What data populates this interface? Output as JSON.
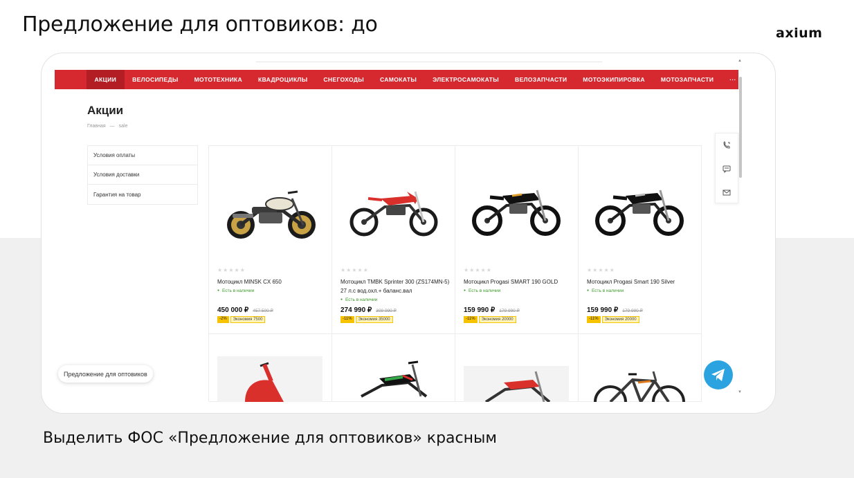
{
  "slide": {
    "title": "Предложение для оптовиков: до",
    "logo": "axium",
    "caption": "Выделить ФОС «Предложение для оптовиков» красным"
  },
  "site": {
    "nav": [
      "АКЦИИ",
      "ВЕЛОСИПЕДЫ",
      "МОТОТЕХНИКА",
      "КВАДРОЦИКЛЫ",
      "СНЕГОХОДЫ",
      "САМОКАТЫ",
      "ЭЛЕКТРОСАМОКАТЫ",
      "ВЕЛОЗАПЧАСТИ",
      "МОТОЭКИПИРОВКА",
      "МОТОЗАПЧАСТИ",
      "···"
    ],
    "active_nav": "АКЦИИ",
    "page_title": "Акции",
    "breadcrumbs": [
      "Главная",
      "—",
      "sale"
    ],
    "sidebar": [
      "Условия оплаты",
      "Условия доставки",
      "Гарантия на товар"
    ],
    "wholesale_button": "Предложение для оптовиков",
    "products": [
      {
        "name": "Мотоцикл MINSK CX 650",
        "availability": "Есть в наличии",
        "price": "450 000 ₽",
        "old_price": "457 500 ₽",
        "discount": "-2%",
        "saving": "Экономия 7500",
        "stars": "★★★★★",
        "image": "retro-motorcycle"
      },
      {
        "name": "Мотоцикл TMBK Sprinter 300 (ZS174MN-5) 27 л.с вод.охл.+ баланс.вал",
        "availability": "Есть в наличии",
        "price": "274 990 ₽",
        "old_price": "309 990 ₽",
        "discount": "-11%",
        "saving": "Экономия 35000",
        "stars": "★★★★★",
        "image": "red-enduro"
      },
      {
        "name": "Мотоцикл Progasi SMART 190 GOLD",
        "availability": "Есть в наличии",
        "price": "159 990 ₽",
        "old_price": "179 990 ₽",
        "discount": "-11%",
        "saving": "Экономия 20000",
        "stars": "★★★★★",
        "image": "black-pitbike"
      },
      {
        "name": "Мотоцикл Progasi Smart 190 Silver",
        "availability": "Есть в наличии",
        "price": "159 990 ₽",
        "old_price": "179 990 ₽",
        "discount": "-11%",
        "saving": "Экономия 20000",
        "stars": "★★★★★",
        "image": "black-pitbike"
      }
    ],
    "second_row_images": [
      "red-scooter",
      "green-pitbike",
      "red-pitbike",
      "mountain-bike"
    ],
    "icons": {
      "callback": "phone-callback-icon",
      "chat": "chat-icon",
      "mail": "mail-icon",
      "telegram": "telegram-icon"
    },
    "colors": {
      "brand_red": "#d6282f",
      "active_red": "#b31e24",
      "in_stock_green": "#3b9b2a",
      "badge_yellow": "#f7c200",
      "telegram_blue": "#2aa3e0"
    }
  }
}
